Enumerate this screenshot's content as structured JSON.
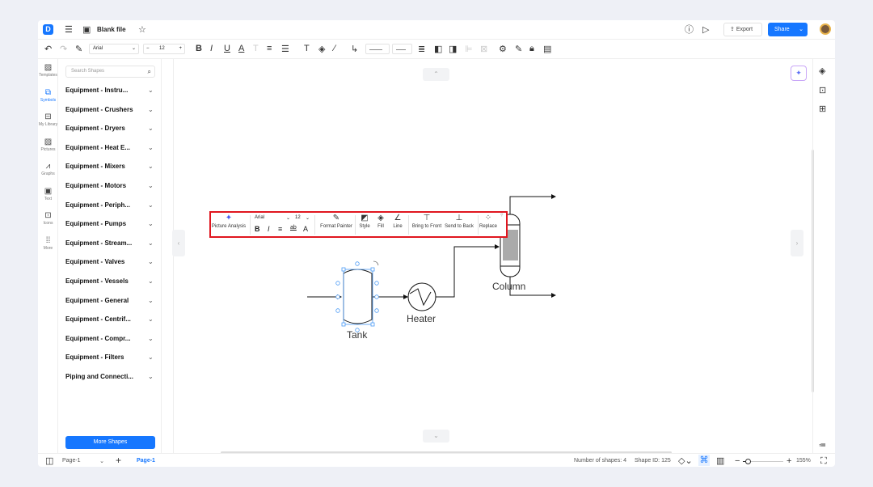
{
  "header": {
    "title": "Blank file",
    "export_label": "Export",
    "share_label": "Share"
  },
  "toolbar": {
    "font": "Arial",
    "font_size": "12"
  },
  "rail": [
    {
      "label": "Templates",
      "icon": "templates-icon"
    },
    {
      "label": "Symbols",
      "icon": "symbols-icon"
    },
    {
      "label": "My Library",
      "icon": "library-icon"
    },
    {
      "label": "Pictures",
      "icon": "pictures-icon"
    },
    {
      "label": "Graphs",
      "icon": "graphs-icon"
    },
    {
      "label": "Text",
      "icon": "text-icon"
    },
    {
      "label": "Icons",
      "icon": "icons-icon"
    },
    {
      "label": "More",
      "icon": "more-icon"
    }
  ],
  "shapes": {
    "search_placeholder": "Search Shapes",
    "more_label": "More Shapes",
    "categories": [
      "Equipment - Instru...",
      "Equipment - Crushers",
      "Equipment - Dryers",
      "Equipment - Heat E...",
      "Equipment - Mixers",
      "Equipment - Motors",
      "Equipment - Periph...",
      "Equipment - Pumps",
      "Equipment - Stream...",
      "Equipment - Valves",
      "Equipment - Vessels",
      "Equipment - General",
      "Equipment - Centrif...",
      "Equipment - Compr...",
      "Equipment - Filters",
      "Piping and Connecti..."
    ]
  },
  "floating": {
    "picture_analysis": "Picture Analysis",
    "font": "Arial",
    "font_size": "12",
    "format_painter": "Format Painter",
    "style": "Style",
    "fill": "Fill",
    "line": "Line",
    "bring_front": "Bring to Front",
    "send_back": "Send to Back",
    "replace": "Replace"
  },
  "diagram": {
    "tank": "Tank",
    "heater": "Heater",
    "column": "Column"
  },
  "status": {
    "page_select": "Page-1",
    "page_tab": "Page-1",
    "shapes_count": "Number of shapes: 4",
    "shape_id": "Shape ID: 125",
    "zoom": "155%",
    "zoom_fraction": 0.12
  },
  "colors": {
    "accent": "#1677ff",
    "selection": "#e0161f",
    "handle": "#4a9af5"
  }
}
